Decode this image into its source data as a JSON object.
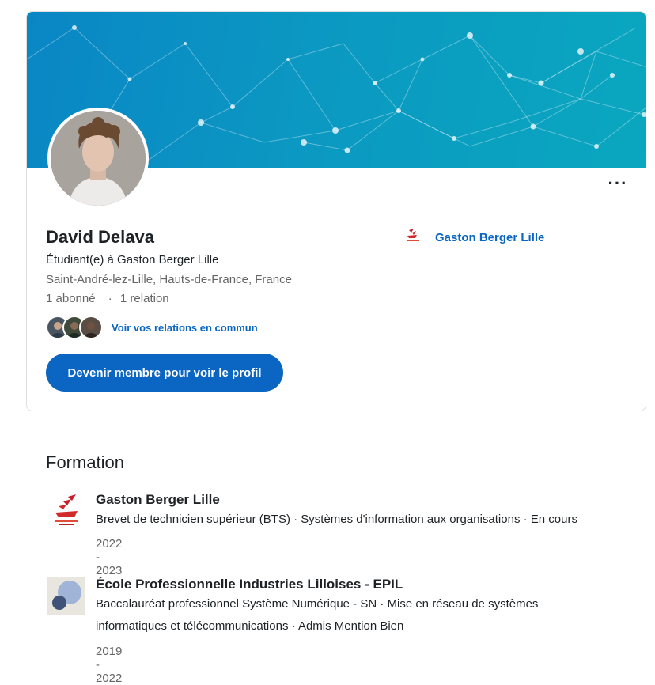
{
  "profile": {
    "name": "David Delava",
    "headline": "Étudiant(e) à Gaston Berger Lille",
    "location": "Saint-André-lez-Lille, Hauts-de-France, France",
    "followers": "1 abonné",
    "connections": "1 relation",
    "separator": "·",
    "mutual_link": "Voir vos relations en commun",
    "join_button": "Devenir membre pour voir le profil",
    "more_label": "···",
    "school_link": "Gaston Berger Lille"
  },
  "formation": {
    "title": "Formation",
    "items": [
      {
        "school": "Gaston Berger Lille",
        "desc_line1": "Brevet de technicien supérieur (BTS) · Systèmes d'information aux organisations · En cours",
        "dates": "2022 - 2023"
      },
      {
        "school": "École Professionnelle Industries Lilloises - EPIL",
        "desc_line1": "Baccalauréat professionnel Système Numérique - SN · Mise en réseau de systèmes",
        "desc_line2": "informatiques et télécommunications · Admis Mention Bien",
        "dates": "2019 - 2022"
      }
    ]
  },
  "colors": {
    "accent": "#0a66c2",
    "banner_start": "#0a86c5",
    "banner_end": "#0aa7bf",
    "secondary_text": "#666666"
  },
  "icons": {
    "more": "ellipsis-icon",
    "school_logo": "gaston-berger-logo",
    "epil_logo": "epil-logo"
  }
}
